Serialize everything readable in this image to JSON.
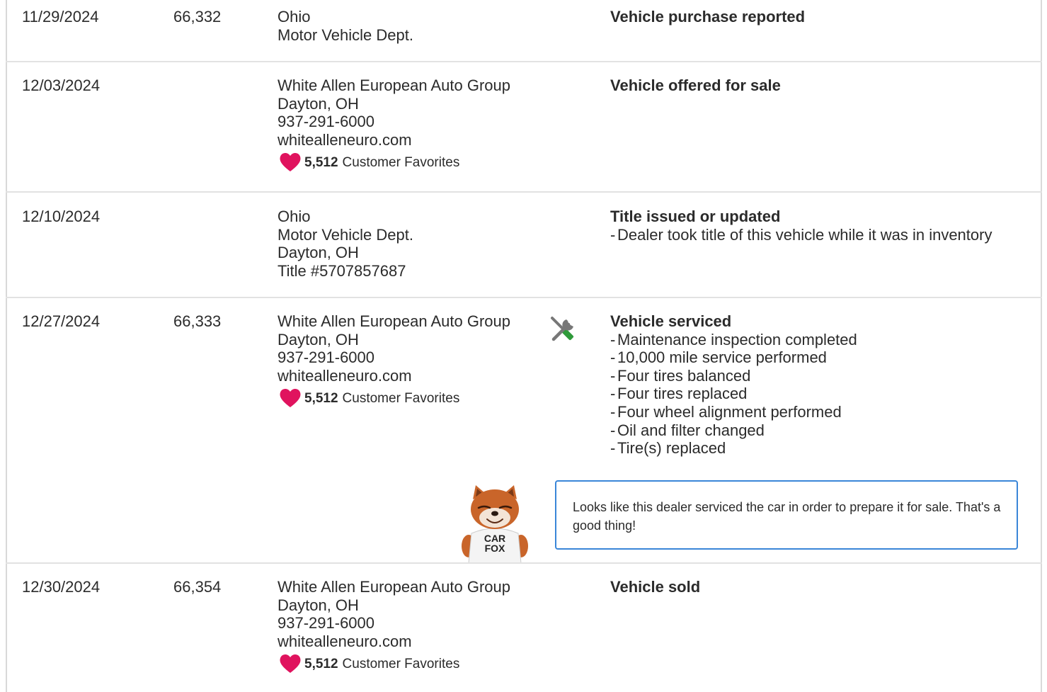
{
  "colors": {
    "heart": "#e0135e",
    "divider": "#e2e2e2",
    "tip_border": "#3a86d8",
    "text": "#2b2b2b",
    "wrench_green": "#2f9a3a",
    "tool_gray": "#777777"
  },
  "records": [
    {
      "date": "11/29/2024",
      "odometer": "66,332",
      "source": [
        "Ohio",
        "Motor Vehicle Dept."
      ],
      "favorites": null,
      "event_title": "Vehicle purchase reported",
      "event_details": []
    },
    {
      "date": "12/03/2024",
      "odometer": "",
      "source": [
        "White Allen European Auto Group",
        "Dayton, OH",
        "937-291-6000",
        "whitealleneuro.com"
      ],
      "favorites": {
        "count": "5,512",
        "label": "Customer Favorites",
        "icon": "heart-icon"
      },
      "event_title": "Vehicle offered for sale",
      "event_details": []
    },
    {
      "date": "12/10/2024",
      "odometer": "",
      "source": [
        "Ohio",
        "Motor Vehicle Dept.",
        "Dayton, OH",
        "Title #5707857687"
      ],
      "favorites": null,
      "event_title": "Title issued or updated",
      "event_details": [
        "Dealer took title of this vehicle while it was in inventory"
      ]
    },
    {
      "date": "12/27/2024",
      "odometer": "66,333",
      "source": [
        "White Allen European Auto Group",
        "Dayton, OH",
        "937-291-6000",
        "whitealleneuro.com"
      ],
      "favorites": {
        "count": "5,512",
        "label": "Customer Favorites",
        "icon": "heart-icon"
      },
      "service_icon": "wrench-screwdriver-icon",
      "event_title": "Vehicle serviced",
      "event_details": [
        "Maintenance inspection completed",
        "10,000 mile service performed",
        "Four tires balanced",
        "Four tires replaced",
        "Four wheel alignment performed",
        "Oil and filter changed",
        "Tire(s) replaced"
      ],
      "tip": {
        "mascot_icon": "carfox-mascot-icon",
        "mascot_shirt": "CAR FOX",
        "text": "Looks like this dealer serviced the car in order to prepare it for sale. That's a good thing!"
      }
    },
    {
      "date": "12/30/2024",
      "odometer": "66,354",
      "source": [
        "White Allen European Auto Group",
        "Dayton, OH",
        "937-291-6000",
        "whitealleneuro.com"
      ],
      "favorites": {
        "count": "5,512",
        "label": "Customer Favorites",
        "icon": "heart-icon"
      },
      "event_title": "Vehicle sold",
      "event_details": []
    }
  ]
}
